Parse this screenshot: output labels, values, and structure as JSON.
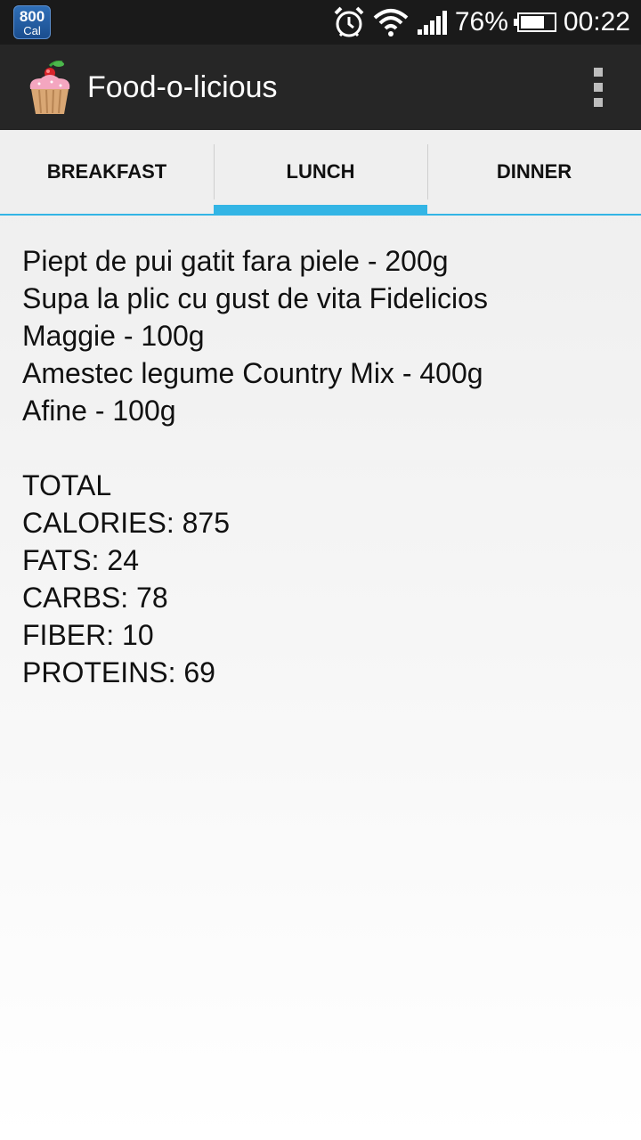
{
  "status_bar": {
    "cal_badge_number": "800",
    "cal_badge_unit": "Cal",
    "battery_percent": "76%",
    "battery_level": 0.76,
    "time": "00:22",
    "icons": [
      "alarm-icon",
      "wifi-icon",
      "signal-icon",
      "battery-icon"
    ]
  },
  "action_bar": {
    "title": "Food-o-licious",
    "icon": "cupcake-icon"
  },
  "tabs": [
    {
      "label": "BREAKFAST",
      "active": false
    },
    {
      "label": "LUNCH",
      "active": true
    },
    {
      "label": "DINNER",
      "active": false
    }
  ],
  "content": {
    "items": [
      "Piept de pui gatit fara piele - 200g",
      "Supa la plic cu gust de vita Fidelicios",
      "Maggie - 100g",
      "Amestec legume Country Mix - 400g",
      "Afine - 100g"
    ],
    "totals": [
      "TOTAL",
      "CALORIES: 875",
      "FATS: 24",
      "CARBS: 78",
      "FIBER: 10",
      "PROTEINS: 69"
    ]
  },
  "colors": {
    "accent": "#33b5e5",
    "action_bar": "#262626",
    "status_bar": "#1a1a1a"
  }
}
